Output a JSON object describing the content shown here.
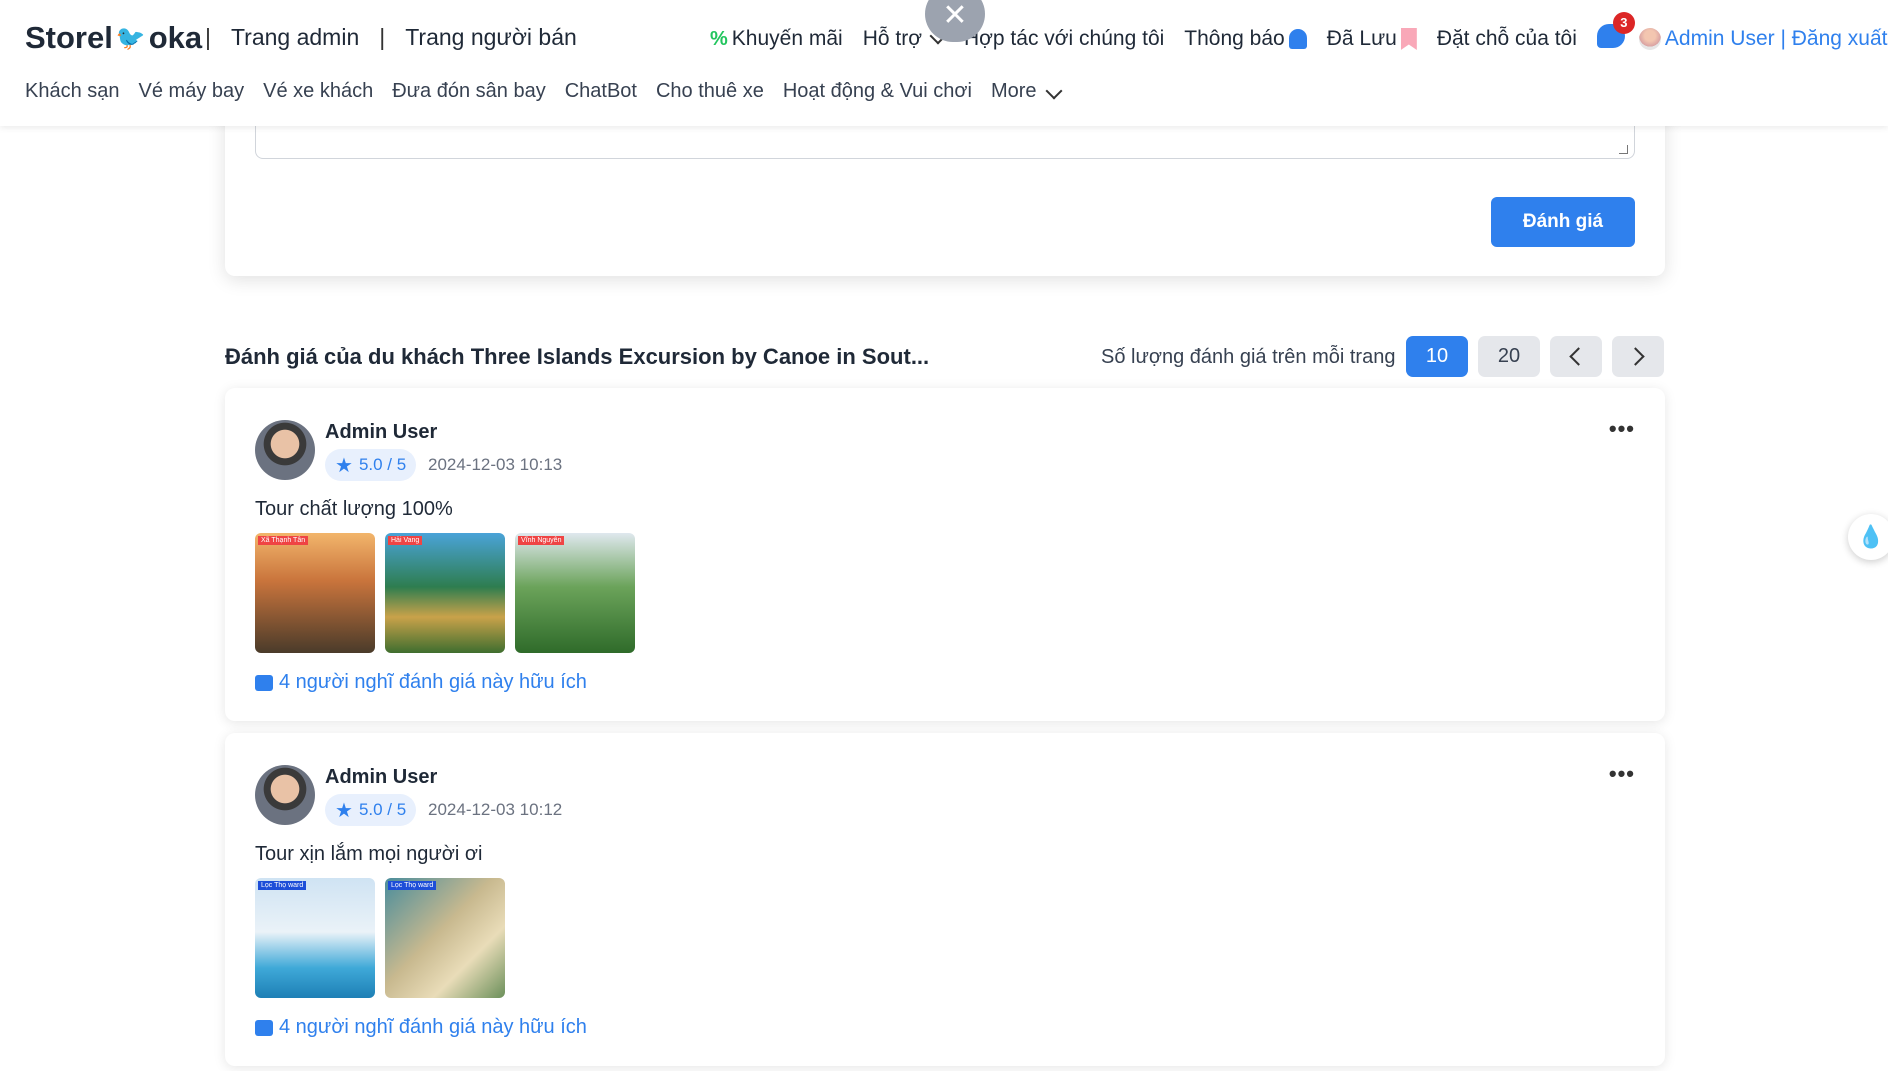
{
  "header": {
    "logo_left": "Storel",
    "logo_right": "oka",
    "top_links": [
      "Trang admin",
      "Trang người bán"
    ],
    "nav": {
      "promo": "Khuyến mãi",
      "support": "Hỗ trợ",
      "partner": "Hợp tác với chúng tôi",
      "notifications": "Thông báo",
      "saved": "Đã Lưu",
      "bookings": "Đặt chỗ của tôi",
      "chat_badge": "3",
      "user": "Admin User | Đăng xuất |"
    },
    "sub_nav": [
      "Khách sạn",
      "Vé máy bay",
      "Vé xe khách",
      "Đưa đón sân bay",
      "ChatBot",
      "Cho thuê xe",
      "Hoạt động & Vui chơi",
      "More"
    ]
  },
  "form": {
    "submit_label": "Đánh giá"
  },
  "reviews_section": {
    "title": "Đánh giá của du khách Three Islands Excursion by Canoe in Sout...",
    "per_page_label": "Số lượng đánh giá trên mỗi trang",
    "per_page_options": [
      "10",
      "20"
    ],
    "selected_per_page": "10"
  },
  "reviews": [
    {
      "author": "Admin User",
      "rating": "5.0 / 5",
      "date": "2024-12-03 10:13",
      "comment": "Tour chất lượng 100%",
      "photo_count": 3,
      "photo_tags": [
        "Xã Thạnh Tân",
        "Hải Vang",
        "Vĩnh Nguyên"
      ],
      "helpful": "4 người nghĩ đánh giá này hữu ích"
    },
    {
      "author": "Admin User",
      "rating": "5.0 / 5",
      "date": "2024-12-03 10:12",
      "comment": "Tour xịn lắm mọi người ơi",
      "photo_count": 2,
      "photo_tags": [
        "Lọc Thọ ward",
        "Lọc Thọ ward"
      ],
      "helpful": "4 người nghĩ đánh giá này hữu ích"
    }
  ],
  "colors": {
    "accent": "#2f80ed",
    "promo": "#22c55e",
    "badge": "#dc2626"
  }
}
